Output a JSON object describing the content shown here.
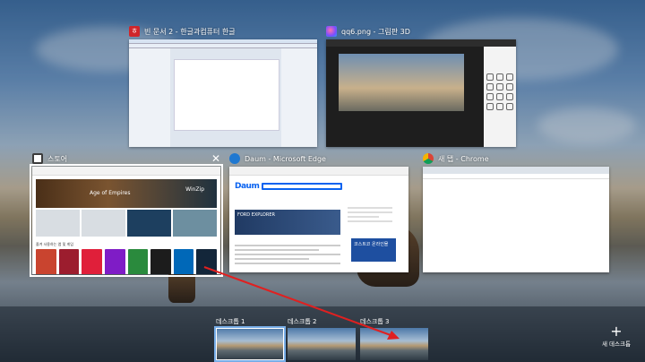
{
  "windows": [
    {
      "title": "빈 문서 2 - 한글과컴퓨터 한글",
      "icon": "hangul-icon"
    },
    {
      "title": "qq6.png - 그림판 3D",
      "icon": "paint3d-icon"
    },
    {
      "title": "스토어",
      "icon": "store-icon"
    },
    {
      "title": "Daum - Microsoft Edge",
      "icon": "edge-icon"
    },
    {
      "title": "새 탭 - Chrome",
      "icon": "chrome-icon"
    }
  ],
  "store": {
    "hero_text": "Age of Empires",
    "apps_caption": "즐겨 사용하는 앱 및 게임",
    "winzip": "WinZip"
  },
  "daum": {
    "logo": "Daum",
    "ad_title": "FORD EXPLORER",
    "costco_text": "코스트코 온라인몰"
  },
  "desktops": [
    {
      "label": "데스크톱 1",
      "active": true
    },
    {
      "label": "데스크톱 2",
      "active": false
    },
    {
      "label": "데스크톱 3",
      "active": false
    }
  ],
  "new_desktop_label": "새 데스크톱",
  "close_glyph": "✕",
  "plus_glyph": "+",
  "colors": {
    "arrow": "#e02020",
    "selection": "#ffffff",
    "active_desktop": "#78aee8"
  }
}
